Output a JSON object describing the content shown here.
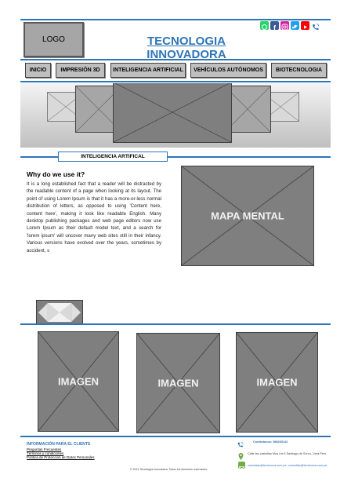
{
  "header": {
    "logo_label": "LOGO",
    "site_title": "TECNOLOGIA INNOVADORA",
    "social_icons": [
      "whatsapp-icon",
      "facebook-icon",
      "instagram-icon",
      "twitter-icon",
      "youtube-icon",
      "phone-icon"
    ]
  },
  "nav": {
    "items": [
      {
        "label": "INICIO"
      },
      {
        "label": "IMPRESIÓN 3D"
      },
      {
        "label": "INTELIGENCIA ARTIFICIAL"
      },
      {
        "label": "VEHÍCULOS AUTÓNOMOS"
      },
      {
        "label": "BIOTECNOLOGIA"
      }
    ]
  },
  "section": {
    "tag": "INTELIGENCIA ARTIFICAL"
  },
  "article": {
    "title": "Why do we use it?",
    "body": "It is a long established fact that a reader will be distracted by the readable content of a page when looking at its layout. The point of using Lorem Ipsum is that it has a more-or-less normal distribution of letters, as opposed to using 'Content here, content here', making it look like readable English. Many desktop publishing packages and web page editors now use Lorem Ipsum as their default model text, and a search for 'lorem ipsum' will uncover many web sites still in their infancy. Various versions have evolved over the years, sometimes by accident, s"
  },
  "mind_map": {
    "label": "MAPA MENTAL"
  },
  "gallery": {
    "items": [
      {
        "label": "IMAGEN"
      },
      {
        "label": "IMAGEN"
      },
      {
        "label": "IMAGEN"
      }
    ]
  },
  "footer": {
    "title": "INFORMACIÓN PARA EL CLIENTE",
    "links": [
      "Preguntas Frecuentes",
      "Términos y condiciones",
      "Política de Protección de Datos Personales"
    ],
    "phone": "Contáctanos: 988265142",
    "address": "Calle las castañas Mza Lte 6 Santiago de Surco, Lima Perú",
    "email": "consultas@tecinnova.com.pe; consultas@tecinnova.com.pe",
    "copyright": "© 2021 Tecnología Innovadora. Todos los derechos reservados."
  },
  "colors": {
    "accent": "#2e75b6",
    "placeholder": "#7f7f7f",
    "nav_button": "#bfbfbf"
  }
}
